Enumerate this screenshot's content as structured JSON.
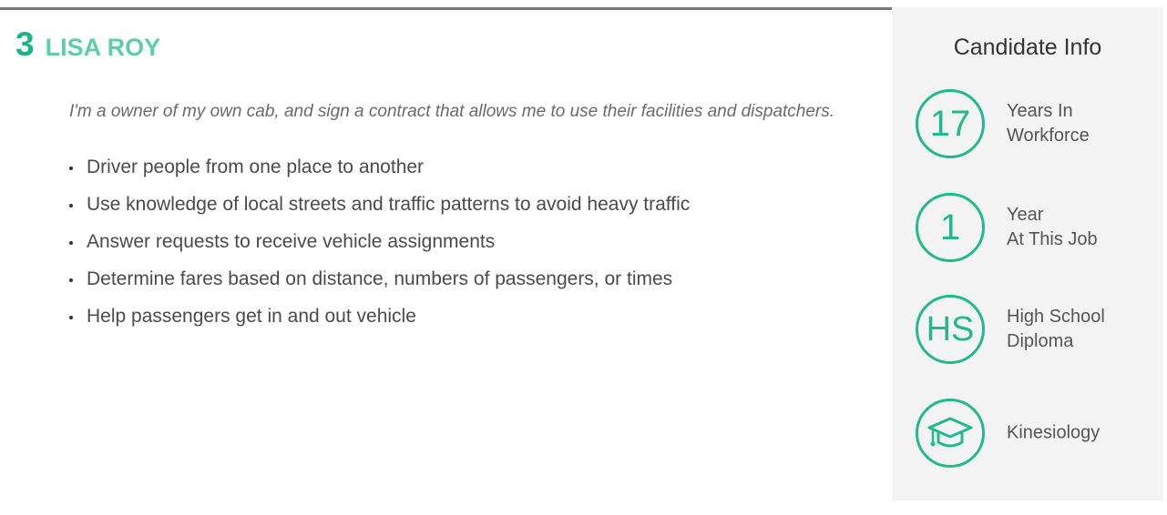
{
  "candidate": {
    "rank": "3",
    "name": "LISA ROY",
    "summary": "I'm a owner of my own cab, and sign a contract that allows me to use their facilities and dispatchers.",
    "duties": [
      "Driver people from one place to another",
      "Use knowledge of local streets and traffic patterns to avoid heavy traffic",
      "Answer requests to receive vehicle assignments",
      "Determine fares based on distance, numbers of passengers, or times",
      "Help passengers get in and out vehicle"
    ]
  },
  "sidebar": {
    "title": "Candidate Info",
    "stats": [
      {
        "value": "17",
        "label_line1": "Years In",
        "label_line2": "Workforce"
      },
      {
        "value": "1",
        "label_line1": "Year",
        "label_line2": "At This Job"
      },
      {
        "value": "HS",
        "label_line1": "High School",
        "label_line2": "Diploma"
      },
      {
        "icon": "graduation-cap-icon",
        "label_line1": "Kinesiology",
        "label_line2": ""
      }
    ]
  },
  "colors": {
    "accent": "#22b98e",
    "name": "#5ecda8",
    "sidebar_bg": "#f3f3f3",
    "rule": "#777777"
  }
}
